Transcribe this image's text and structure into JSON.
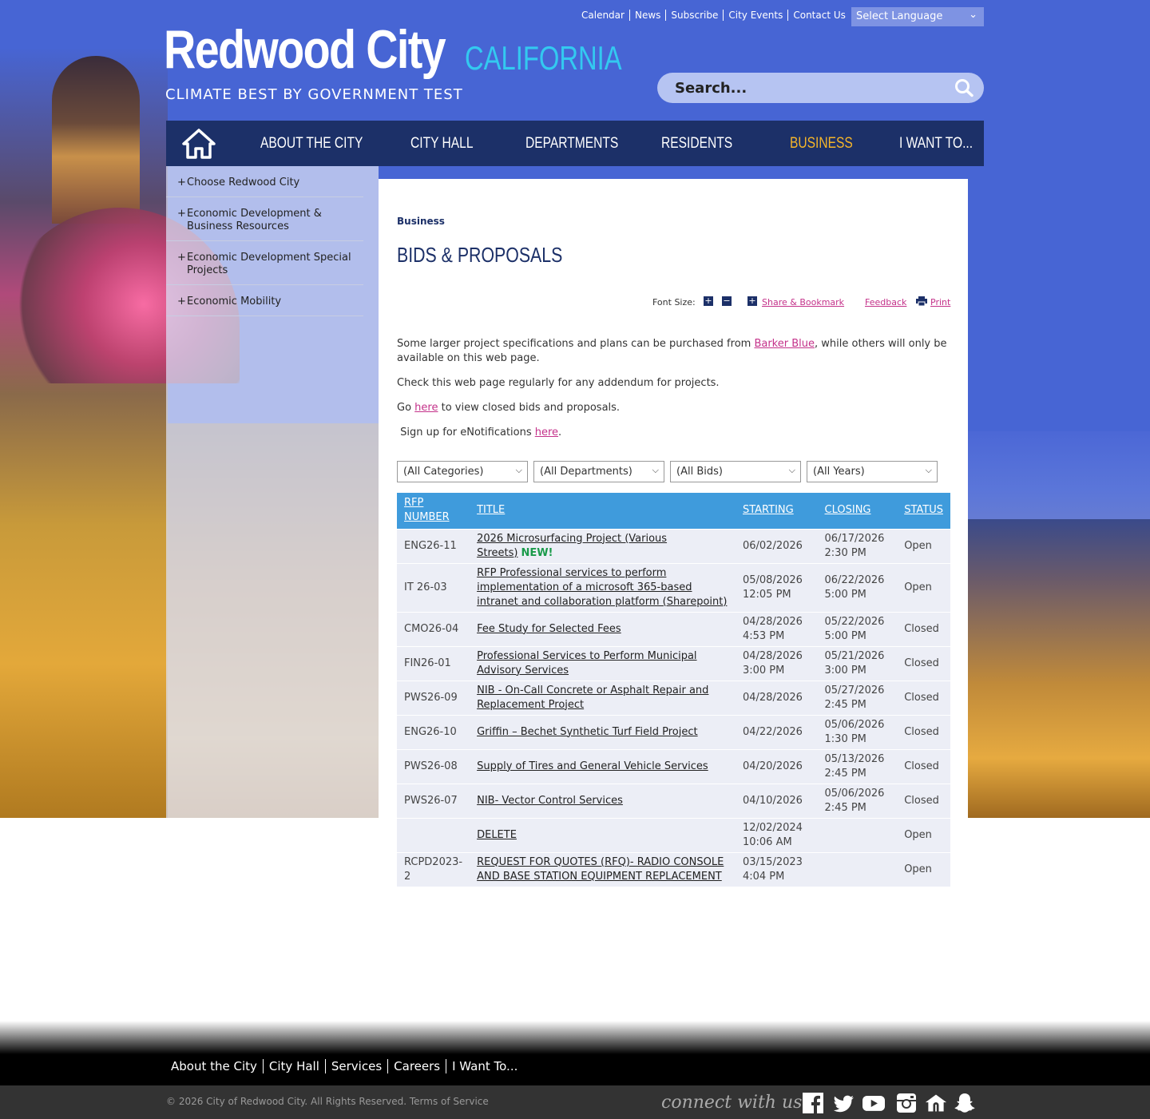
{
  "header": {
    "utility_links": [
      "Calendar",
      "News",
      "Subscribe",
      "City Events",
      "Contact Us"
    ],
    "language_select": "Select Language",
    "logo_title": "Redwood City",
    "logo_state": "CALIFORNIA",
    "tagline": "CLIMATE BEST BY GOVERNMENT TEST",
    "search_placeholder": "Search..."
  },
  "nav": {
    "items": [
      "ABOUT THE CITY",
      "CITY HALL",
      "DEPARTMENTS",
      "RESIDENTS",
      "BUSINESS",
      "I WANT TO..."
    ],
    "active": "BUSINESS"
  },
  "sidebar": {
    "items": [
      "Choose Redwood City",
      "Economic Development & Business Resources",
      "Economic Development Special Projects",
      "Economic Mobility"
    ]
  },
  "page": {
    "breadcrumb": "Business",
    "title": "BIDS & PROPOSALS",
    "tools": {
      "font_size_label": "Font Size:",
      "share": "Share & Bookmark",
      "feedback": "Feedback",
      "print": "Print"
    },
    "paragraphs": {
      "p1_pre": "Some larger project specifications and plans can be purchased from ",
      "p1_link": "Barker Blue",
      "p1_post": ", while others will only be available on this web page.",
      "p2": "Check this web page regularly for any addendum for projects.",
      "p3_pre": "Go ",
      "p3_link": "here",
      "p3_post": " to view closed bids and proposals.",
      "p4_pre": " Sign up for eNotifications ",
      "p4_link": "here",
      "p4_post": "."
    },
    "filters": [
      "(All Categories)",
      "(All Departments)",
      "(All Bids)",
      "(All Years)"
    ]
  },
  "table": {
    "headers": [
      "RFP NUMBER",
      "TITLE",
      "STARTING",
      "CLOSING",
      "STATUS"
    ],
    "rows": [
      {
        "num": "ENG26-11",
        "title": "2026 Microsurfacing Project (Various Streets)",
        "new": "NEW!",
        "start": "06/02/2026",
        "close": "06/17/2026 2:30 PM",
        "status": "Open"
      },
      {
        "num": "IT 26-03",
        "title": "RFP Professional services to perform implementation of a microsoft 365-based intranet and collaboration platform (Sharepoint)",
        "new": "",
        "start": "05/08/2026 12:05 PM",
        "close": "06/22/2026 5:00 PM",
        "status": "Open"
      },
      {
        "num": "CMO26-04",
        "title": "Fee Study for Selected Fees",
        "new": "",
        "start": "04/28/2026 4:53 PM",
        "close": "05/22/2026 5:00 PM",
        "status": "Closed"
      },
      {
        "num": "FIN26-01",
        "title": "Professional Services to Perform Municipal Advisory Services",
        "new": "",
        "start": "04/28/2026 3:00 PM",
        "close": "05/21/2026 3:00 PM",
        "status": "Closed"
      },
      {
        "num": "PWS26-09",
        "title": "NIB - On-Call Concrete or Asphalt Repair and Replacement Project",
        "new": "",
        "start": "04/28/2026",
        "close": "05/27/2026 2:45 PM",
        "status": "Closed"
      },
      {
        "num": "ENG26-10",
        "title": "Griffin – Bechet Synthetic Turf Field Project",
        "new": "",
        "start": "04/22/2026",
        "close": "05/06/2026 1:30 PM",
        "status": "Closed"
      },
      {
        "num": "PWS26-08",
        "title": "Supply of Tires and General Vehicle Services",
        "new": "",
        "start": "04/20/2026",
        "close": "05/13/2026 2:45 PM",
        "status": "Closed"
      },
      {
        "num": "PWS26-07",
        "title": "NIB- Vector Control Services",
        "new": "",
        "start": "04/10/2026",
        "close": "05/06/2026 2:45 PM",
        "status": "Closed"
      },
      {
        "num": "",
        "title": "DELETE",
        "new": "",
        "start": "12/02/2024 10:06 AM",
        "close": "",
        "status": "Open"
      },
      {
        "num": "RCPD2023-2",
        "title": "REQUEST FOR QUOTES (RFQ)- RADIO CONSOLE AND BASE STATION EQUIPMENT REPLACEMENT",
        "new": "",
        "start": "03/15/2023 4:04 PM",
        "close": "",
        "status": "Open"
      }
    ]
  },
  "footer": {
    "links": [
      "About the City",
      "City Hall",
      "Services",
      "Careers",
      "I Want To..."
    ],
    "copyright": "© 2026 City of Redwood City. All Rights Reserved. Terms of Service",
    "connect": "connect with us",
    "social_icons": [
      "facebook-icon",
      "twitter-icon",
      "youtube-icon",
      "instagram-icon",
      "nextdoor-icon",
      "snapchat-icon"
    ]
  },
  "colors": {
    "header_blue": "#4765d4",
    "nav_dark": "#1c3068",
    "active_nav": "#f5b52a",
    "table_header": "#3f9bdc",
    "link_pink": "#c4328a",
    "new_green": "#1a9a4a"
  }
}
